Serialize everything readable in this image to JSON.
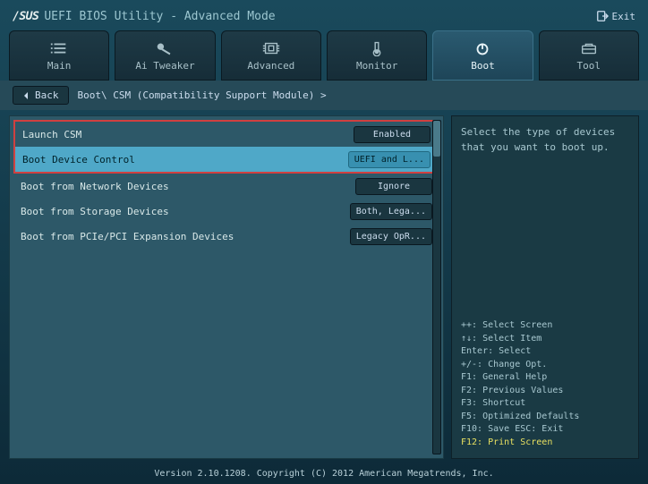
{
  "header": {
    "brand": "/SUS",
    "title": "UEFI BIOS Utility - Advanced Mode",
    "exit": "Exit"
  },
  "tabs": [
    {
      "label": "Main"
    },
    {
      "label": "Ai Tweaker"
    },
    {
      "label": "Advanced"
    },
    {
      "label": "Monitor"
    },
    {
      "label": "Boot"
    },
    {
      "label": "Tool"
    }
  ],
  "crumb": {
    "back": "Back",
    "path": "Boot\\ CSM (Compatibility Support Module) >"
  },
  "options": [
    {
      "label": "Launch CSM",
      "value": "Enabled",
      "highlighted": true,
      "selected": false
    },
    {
      "label": "Boot Device Control",
      "value": "UEFI and L...",
      "highlighted": true,
      "selected": true
    },
    {
      "label": "Boot from Network Devices",
      "value": "Ignore",
      "highlighted": false,
      "selected": false
    },
    {
      "label": "Boot from Storage Devices",
      "value": "Both, Lega...",
      "highlighted": false,
      "selected": false
    },
    {
      "label": "Boot from PCIe/PCI Expansion Devices",
      "value": "Legacy OpR...",
      "highlighted": false,
      "selected": false
    }
  ],
  "help": {
    "desc": "Select the type of devices that you want to boot up.",
    "keys": [
      "++: Select Screen",
      "↑↓: Select Item",
      "Enter: Select",
      "+/-: Change Opt.",
      "F1: General Help",
      "F2: Previous Values",
      "F3: Shortcut",
      "F5: Optimized Defaults",
      "F10: Save  ESC: Exit"
    ],
    "yellow": "F12: Print Screen"
  },
  "footer": "Version 2.10.1208. Copyright (C) 2012 American Megatrends, Inc."
}
